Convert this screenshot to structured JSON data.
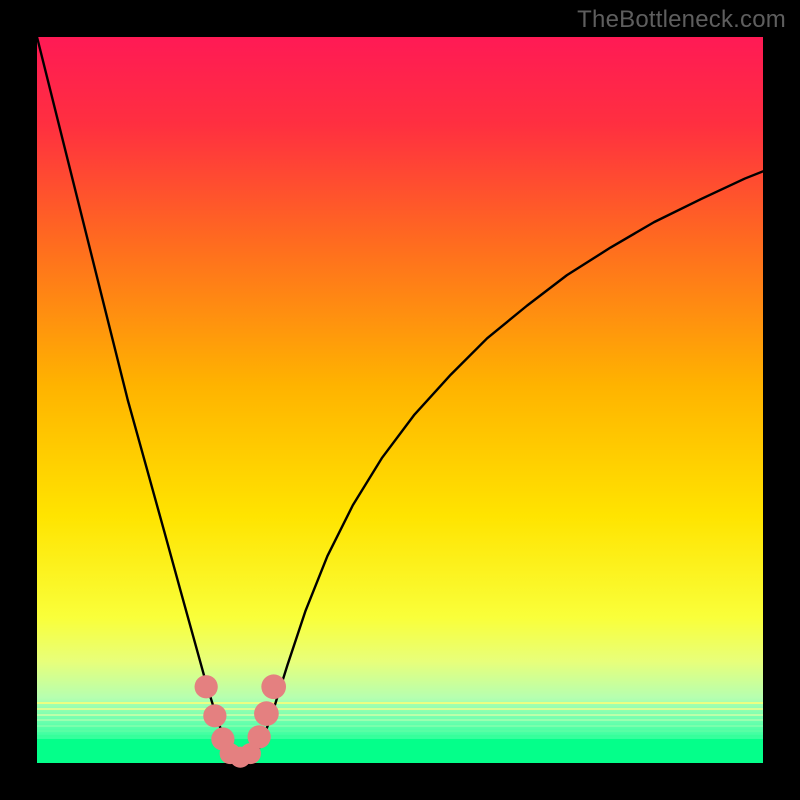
{
  "watermark": "TheBottleneck.com",
  "chart_data": {
    "type": "line",
    "title": "",
    "xlabel": "",
    "ylabel": "",
    "xlim": [
      0,
      100
    ],
    "ylim": [
      0,
      100
    ],
    "grid": false,
    "legend": false,
    "gradient_stops": [
      {
        "pct": 0,
        "color": "#ff1a55"
      },
      {
        "pct": 12,
        "color": "#ff2f40"
      },
      {
        "pct": 28,
        "color": "#ff6a20"
      },
      {
        "pct": 48,
        "color": "#ffb300"
      },
      {
        "pct": 66,
        "color": "#ffe400"
      },
      {
        "pct": 80,
        "color": "#f9ff3a"
      },
      {
        "pct": 86,
        "color": "#e8ff7a"
      },
      {
        "pct": 91,
        "color": "#b6ffb0"
      },
      {
        "pct": 94,
        "color": "#71ffb0"
      },
      {
        "pct": 96.5,
        "color": "#36ff9e"
      },
      {
        "pct": 100,
        "color": "#04ff8a"
      }
    ],
    "green_band_top_pct": 96.7,
    "bottom_thin_lines": [
      {
        "top_pct": 91.6,
        "color": "#ecff82"
      },
      {
        "top_pct": 92.4,
        "color": "#d9ff96"
      },
      {
        "top_pct": 93.2,
        "color": "#bdffaa"
      },
      {
        "top_pct": 94.0,
        "color": "#9cffb0"
      },
      {
        "top_pct": 94.8,
        "color": "#7affac"
      },
      {
        "top_pct": 95.5,
        "color": "#57ffa4"
      },
      {
        "top_pct": 96.1,
        "color": "#36ff9a"
      }
    ],
    "series": [
      {
        "name": "bottleneck-curve",
        "x": [
          0.0,
          2.5,
          5.0,
          7.5,
          10.0,
          12.5,
          15.0,
          17.5,
          19.7,
          21.5,
          23.3,
          25.0,
          26.5,
          27.5,
          28.8,
          30.5,
          32.3,
          34.5,
          37.0,
          40.0,
          43.5,
          47.5,
          52.0,
          57.0,
          62.0,
          67.5,
          73.0,
          79.0,
          85.0,
          91.5,
          97.5,
          100.0
        ],
        "y": [
          100.0,
          90.0,
          80.0,
          70.0,
          60.0,
          50.0,
          41.0,
          32.0,
          24.0,
          17.5,
          11.0,
          5.5,
          1.7,
          0.0,
          0.0,
          1.8,
          6.5,
          13.5,
          21.0,
          28.5,
          35.5,
          42.0,
          48.0,
          53.5,
          58.5,
          63.0,
          67.2,
          71.0,
          74.5,
          77.7,
          80.5,
          81.5
        ]
      }
    ],
    "markers": [
      {
        "x": 23.3,
        "y": 10.5,
        "r": 1.6
      },
      {
        "x": 24.5,
        "y": 6.5,
        "r": 1.6
      },
      {
        "x": 25.6,
        "y": 3.3,
        "r": 1.6
      },
      {
        "x": 26.6,
        "y": 1.3,
        "r": 1.45
      },
      {
        "x": 28.0,
        "y": 0.8,
        "r": 1.45
      },
      {
        "x": 29.4,
        "y": 1.3,
        "r": 1.45
      },
      {
        "x": 30.6,
        "y": 3.6,
        "r": 1.6
      },
      {
        "x": 31.6,
        "y": 6.8,
        "r": 1.7
      },
      {
        "x": 32.6,
        "y": 10.5,
        "r": 1.7
      }
    ]
  }
}
